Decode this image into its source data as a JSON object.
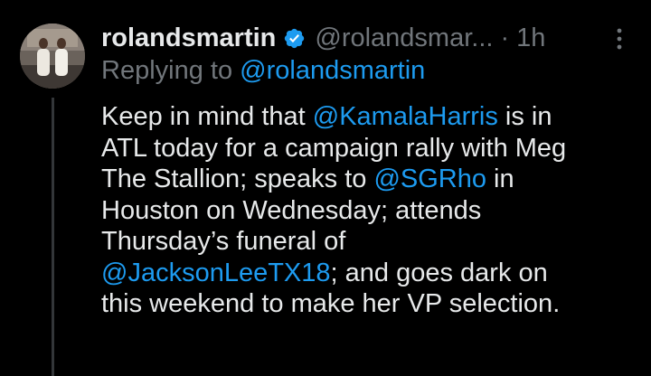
{
  "tweet": {
    "display_name": "rolandsmartin",
    "handle": "@rolandsmar...",
    "separator": "·",
    "time": "1h",
    "replying_prefix": "Replying to ",
    "replying_handle": "@rolandsmartin",
    "icons": {
      "verified": "verified-badge-icon",
      "more": "more-vertical-icon"
    },
    "colors": {
      "link": "#1d9bf0",
      "text": "#e7e9ea",
      "muted": "#71767b",
      "background": "#000000"
    },
    "body_lines": [
      {
        "segments": [
          {
            "text": "Keep in mind that "
          },
          {
            "text": "@KamalaHarris",
            "mention": true
          },
          {
            "text": " is in"
          }
        ]
      },
      {
        "segments": [
          {
            "text": "ATL today for a campaign rally with Meg"
          }
        ]
      },
      {
        "segments": [
          {
            "text": "The Stallion; speaks to "
          },
          {
            "text": "@SGRho",
            "mention": true
          },
          {
            "text": " in"
          }
        ]
      },
      {
        "segments": [
          {
            "text": "Houston on Wednesday; attends"
          }
        ]
      },
      {
        "segments": [
          {
            "text": "Thursday’s funeral of"
          }
        ]
      },
      {
        "segments": [
          {
            "text": "@JacksonLeeTX18",
            "mention": true
          },
          {
            "text": "; and goes dark on"
          }
        ]
      },
      {
        "segments": [
          {
            "text": "this weekend to make her VP selection."
          }
        ]
      }
    ]
  }
}
